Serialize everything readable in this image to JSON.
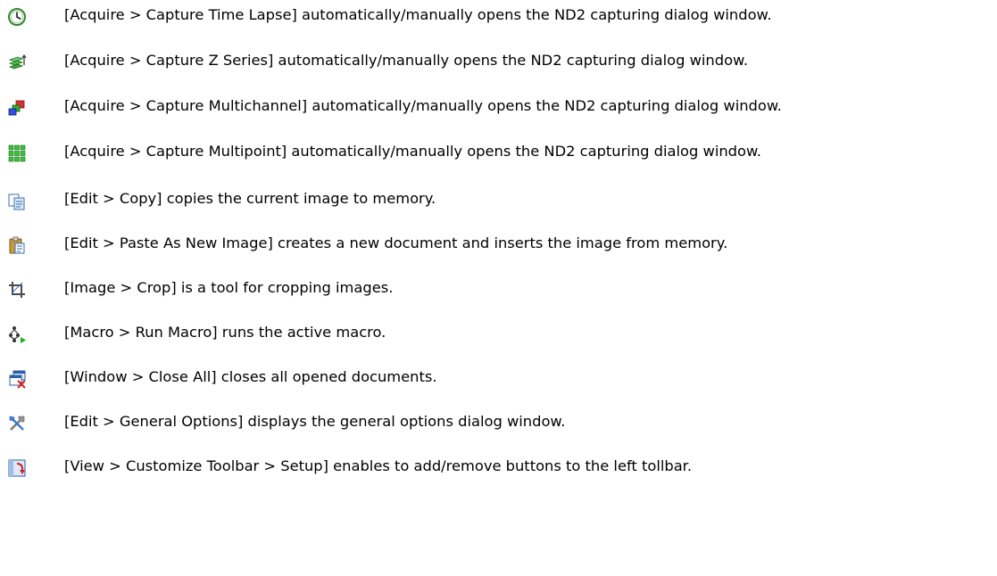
{
  "items": [
    {
      "icon": "clock-icon",
      "text": "[Acquire > Capture Time Lapse] automatically/manually opens the ND2 capturing dialog window."
    },
    {
      "icon": "z-series-icon",
      "text": "[Acquire > Capture Z Series] automatically/manually opens the ND2 capturing dialog window."
    },
    {
      "icon": "multichannel-icon",
      "text": "[Acquire > Capture Multichannel] automatically/manually opens the ND2 capturing dialog window."
    },
    {
      "icon": "multipoint-icon",
      "text": "[Acquire > Capture Multipoint] automatically/manually opens the ND2 capturing dialog window."
    },
    {
      "icon": "copy-icon",
      "text": "[Edit > Copy] copies the current image to memory."
    },
    {
      "icon": "paste-icon",
      "text": "[Edit > Paste As New Image] creates a new document and inserts the image from memory."
    },
    {
      "icon": "crop-icon",
      "text": "[Image > Crop] is a tool for cropping images."
    },
    {
      "icon": "run-macro-icon",
      "text": "[Macro > Run Macro] runs the active macro."
    },
    {
      "icon": "close-all-icon",
      "text": "[Window > Close All] closes all opened documents."
    },
    {
      "icon": "tools-icon",
      "text": "[Edit > General Options] displays the general options dialog window."
    },
    {
      "icon": "customize-toolbar-icon",
      "text": "[View > Customize Toolbar > Setup] enables to add/remove buttons to the left tollbar."
    }
  ]
}
